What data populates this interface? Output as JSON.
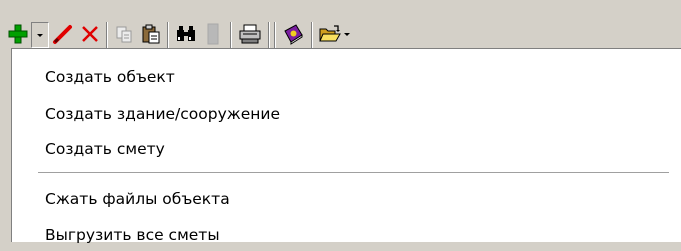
{
  "toolbar": {
    "icons": [
      {
        "name": "add-icon",
        "color": "#00a000"
      },
      {
        "name": "dropdown-arrow-icon"
      },
      {
        "name": "edit-pencil-icon",
        "color": "#e00000"
      },
      {
        "name": "delete-icon",
        "color": "#e00000"
      },
      {
        "name": "copy-icon"
      },
      {
        "name": "paste-icon"
      },
      {
        "name": "find-binoculars-icon"
      },
      {
        "name": "disabled-icon"
      },
      {
        "name": "print-icon"
      },
      {
        "name": "help-book-icon",
        "color": "#7a1fa0"
      },
      {
        "name": "open-folder-icon",
        "color": "#f0c020"
      }
    ]
  },
  "menu": {
    "items": [
      {
        "label": "Создать объект"
      },
      {
        "label": "Создать здание/сооружение"
      },
      {
        "label": "Создать смету"
      },
      {
        "label": "Сжать файлы объекта"
      },
      {
        "label": "Выгрузить все сметы"
      }
    ]
  }
}
